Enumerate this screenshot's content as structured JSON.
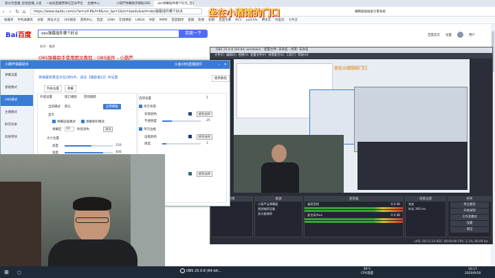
{
  "browser": {
    "tabs": [
      {
        "label": "爱分享直播_思语直播_斗鱼直播",
        "active": false
      },
      {
        "label": "一站式直播营销与互动平台",
        "active": false
      },
      {
        "label": "主播中心",
        "active": false
      },
      {
        "label": "",
        "active": false
      },
      {
        "label": "小葫芦弹幕助手辅助OBS",
        "active": false
      },
      {
        "label": "obs弹幕插件哪个好点_百度搜索",
        "active": true
      }
    ],
    "url": "https://www.baidu.com/s?ie=utf-8&f=8&rsv_bp=1&tn=baidu&wd=obs弹幕插件哪个好点",
    "right_tab": "赛腾超级搜索引擎系统"
  },
  "bookmarks": [
    "收藏夹",
    "手机收藏夹",
    "谷歌",
    "网址大全",
    "360搜索",
    "游戏中心",
    "百度",
    "1080",
    "在线课程",
    "LINUX",
    "导航",
    "MMM",
    "百度翻译",
    "直播",
    "影视",
    "知网",
    "百度文库",
    "NCC",
    "pod.life",
    "腾讯云",
    "阿里云",
    "七牛云"
  ],
  "overlay_text": "坐在小酒馆的门口",
  "baidu": {
    "logo_left": "Bai",
    "logo_right": "百度",
    "query": "obs弹幕插件哪个好点",
    "search_button": "百度一下",
    "userlinks": [
      "百度首页",
      "设置",
      "用户"
    ],
    "result_sub": "知乎 · 推荐",
    "result_title": "OBS弹幕助手使用图文教程 - OBS插件 - 小葫芦"
  },
  "tool": {
    "title": "小葫芦弹幕助手",
    "title_right": "斗鱼OBS直播插件",
    "sidebar": [
      "弹幕设置",
      "基础模式",
      "OBS模式",
      "主播模式",
      "鲜花效果",
      "高级特效"
    ],
    "selected_index": 2,
    "tip": "将弹幕效果显示在OBS中，请在【捕获窗口】中设置",
    "tip_button": "使用教程",
    "subtabs": [
      "列表设置",
      "弹幕"
    ],
    "sec_general": "外观设置",
    "opt1": "窗口捕捉",
    "opt2": "游戏捕获",
    "custom_label": "当前模式",
    "custom_val": "默认",
    "btn_apply": "应用模板",
    "section_display": "显示",
    "mode_label": "弹幕层级模式",
    "mode_label2": "弹幕保护模式",
    "scroll_label": "弹幕区",
    "scroll_val": "20",
    "scroll_unit": "秒后消失",
    "test_btn": "测试",
    "section_size": "大小位置",
    "height_label": "高度",
    "height_val": "220",
    "width_label": "宽度",
    "width_val": "400",
    "right_title": "选项设置",
    "right_num": "1",
    "cb1": "单元背景",
    "bg_color_label": "背景颜色",
    "pick_btn": "颜色选择",
    "opacity_label": "不透明度",
    "opacity_val": "25",
    "cb2": "单元边框",
    "border_color_label": "边框颜色",
    "border_w_label": "厚度",
    "border_w_val": "1",
    "accent": "#3a7bd5"
  },
  "obs": {
    "title": "OBS 25.0.8 (64-bit, windows) - 配置文件: 未命名 - 场景: 未命名",
    "menu": [
      "文件(F)",
      "编辑(E)",
      "视图(V)",
      "配置文件(P)",
      "场景集合(S)",
      "工具(T)",
      "帮助(H)"
    ],
    "scenes_title": "场景",
    "sources_title": "来源",
    "sources": [
      "小葫芦云弹幕窗",
      "视频捕获设备",
      "显示器捕获"
    ],
    "mixer_title": "混音器",
    "mixer": [
      {
        "name": "桌面音频",
        "db": "0.0 dB"
      },
      {
        "name": "麦克风/Aux",
        "db": "0.0 dB"
      }
    ],
    "transitions_title": "场景过渡",
    "transition_type": "渐变",
    "duration_label": "时长",
    "duration_val": "300 ms",
    "controls_title": "控件",
    "controls": [
      "停止推流",
      "开始录制",
      "工作室模式",
      "设置",
      "退出"
    ],
    "status": "LIVE: 00:11:24   REC: 00:00:00   CPU: 2.1%, 60.00 fps"
  },
  "taskbar": {
    "obs_label": "OBS 25.0.8 (64-bit...",
    "cpu_temp": "56°C",
    "cpu_label": "CPU温度",
    "time": "16:17",
    "date": "2020/9/18"
  }
}
